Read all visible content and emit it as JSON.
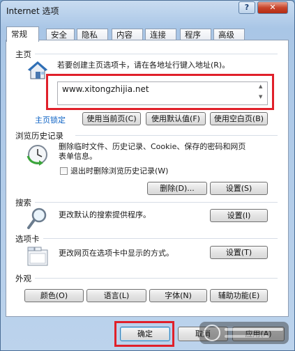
{
  "window": {
    "title": "Internet 选项",
    "help_label": "?",
    "close_label": "✕"
  },
  "tabs": [
    {
      "label": "常规",
      "active": true
    },
    {
      "label": "安全"
    },
    {
      "label": "隐私"
    },
    {
      "label": "内容"
    },
    {
      "label": "连接"
    },
    {
      "label": "程序"
    },
    {
      "label": "高级"
    }
  ],
  "homepage": {
    "title": "主页",
    "description": "若要创建主页选项卡，请在各地址行键入地址(R)。",
    "url": "www.xitongzhijia.net",
    "lock_link": "主页锁定",
    "use_current": "使用当前页(C)",
    "use_default": "使用默认值(F)",
    "use_blank": "使用空白页(B)",
    "icon": "house-icon"
  },
  "history": {
    "title": "浏览历史记录",
    "description_line1": "删除临时文件、历史记录、Cookie、保存的密码和网页",
    "description_line2": "表单信息。",
    "checkbox_label": "退出时删除浏览历史记录(W)",
    "delete_label": "删除(D)...",
    "settings_label": "设置(S)",
    "icon": "history-clock-icon"
  },
  "search": {
    "title": "搜索",
    "description": "更改默认的搜索提供程序。",
    "settings_label": "设置(I)",
    "icon": "magnifier-icon"
  },
  "tabs_section": {
    "title": "选项卡",
    "description": "更改网页在选项卡中显示的方式。",
    "settings_label": "设置(T)",
    "icon": "tabs-window-icon"
  },
  "appearance": {
    "title": "外观",
    "colors_label": "颜色(O)",
    "languages_label": "语言(L)",
    "fonts_label": "字体(N)",
    "accessibility_label": "辅助功能(E)"
  },
  "footer": {
    "ok_label": "确定",
    "cancel_label": "取消",
    "apply_label": "应用(A)"
  }
}
